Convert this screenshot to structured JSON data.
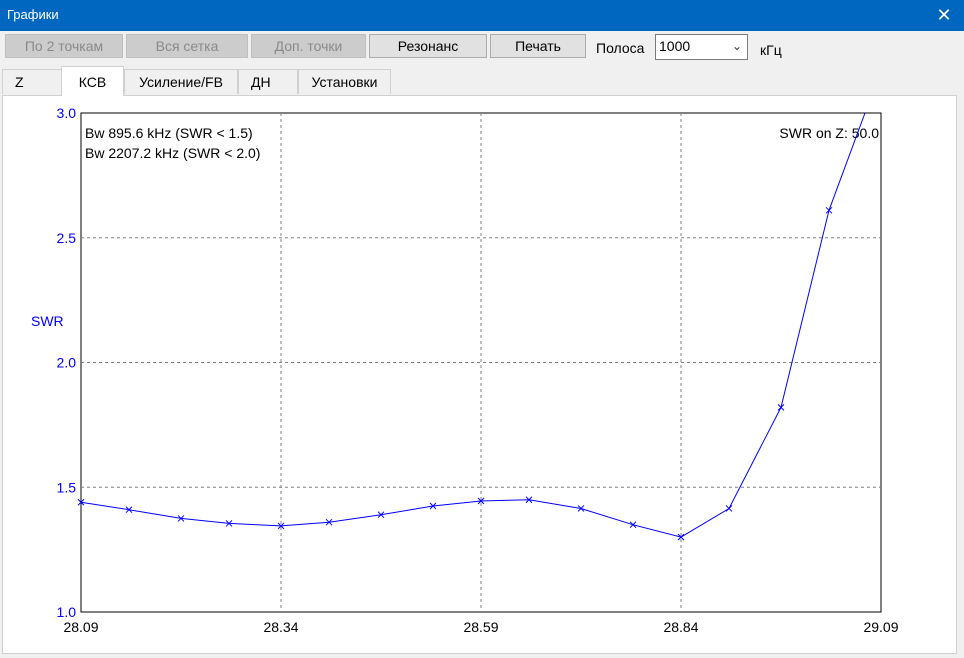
{
  "window": {
    "title": "Графики",
    "close_glyph": "✕"
  },
  "toolbar": {
    "btn_two_points": "По 2 точкам",
    "btn_whole_grid": "Вся сетка",
    "btn_extra_points": "Доп. точки",
    "btn_resonance": "Резонанс",
    "btn_print": "Печать",
    "band_label": "Полоса",
    "band_value": "1000",
    "band_unit": "кГц"
  },
  "tabs": [
    {
      "label": "Z",
      "active": false
    },
    {
      "label": "КСВ",
      "active": true
    },
    {
      "label": "Усиление/FB",
      "active": false
    },
    {
      "label": "ДН",
      "active": false
    },
    {
      "label": "Установки",
      "active": false
    }
  ],
  "chart_data": {
    "type": "line",
    "ylabel": "SWR",
    "annotations": {
      "bw1": "Bw 895.6 kHz (SWR < 1.5)",
      "bw2": "Bw 2207.2 kHz (SWR < 2.0)",
      "zref": "SWR on Z: 50.0"
    },
    "xlim": [
      28.09,
      29.09
    ],
    "ylim": [
      1.0,
      3.0
    ],
    "x_ticks": [
      "28.09",
      "28.34",
      "28.59",
      "28.84",
      "29.09"
    ],
    "y_ticks": [
      "1.0",
      "1.5",
      "2.0",
      "2.5",
      "3.0"
    ],
    "grid": true,
    "line_color": "#0000ff",
    "series": [
      {
        "x": [
          28.09,
          28.15,
          28.215,
          28.275,
          28.34,
          28.4,
          28.465,
          28.53,
          28.59,
          28.65,
          28.715,
          28.78,
          28.84,
          28.9,
          28.965,
          29.025,
          29.07
        ],
        "y": [
          1.44,
          1.41,
          1.375,
          1.355,
          1.345,
          1.36,
          1.39,
          1.425,
          1.445,
          1.45,
          1.415,
          1.35,
          1.3,
          1.415,
          1.82,
          2.61,
          3.0
        ]
      }
    ]
  }
}
